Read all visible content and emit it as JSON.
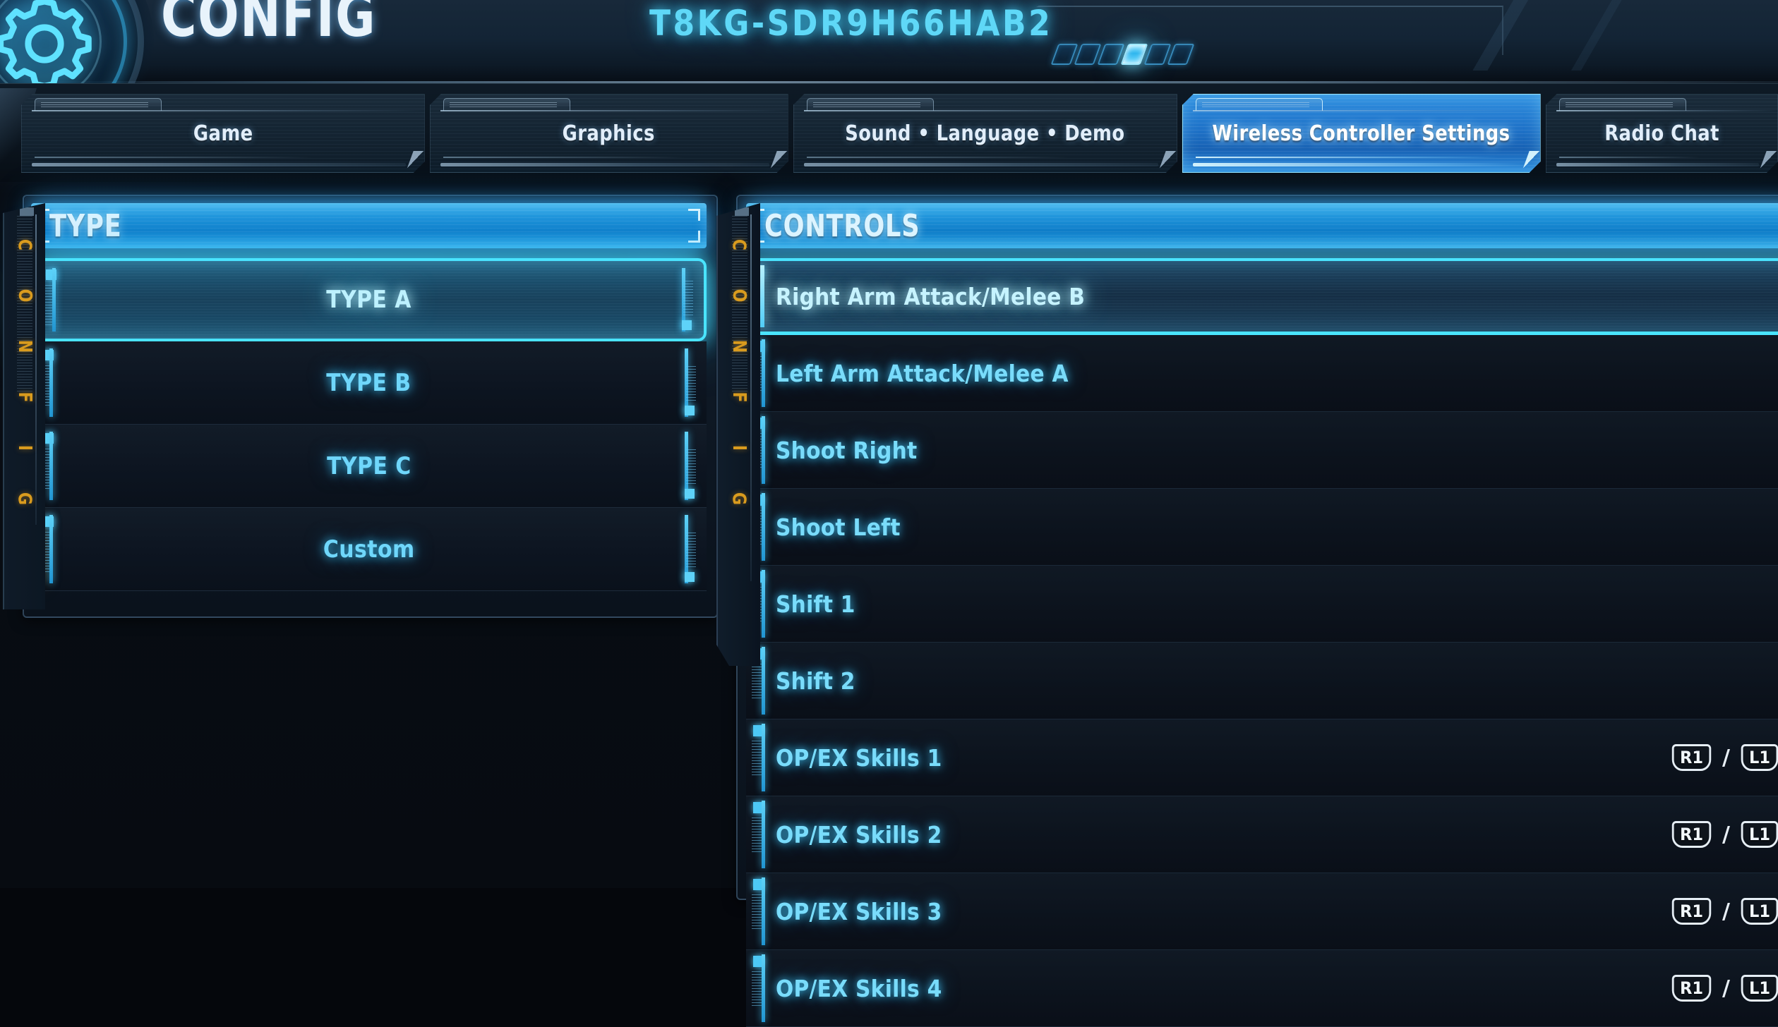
{
  "header": {
    "title": "CONFIG",
    "code": "T8KG-SDR9H66HAB2",
    "gear_icon": "gear-icon",
    "segments": {
      "count": 6,
      "active_index": 3
    },
    "accent_cyan": "#4ae4ff",
    "accent_blue": "#1f93da",
    "accent_amber": "#d99b1e"
  },
  "tabs": [
    {
      "label": "Game",
      "active": false
    },
    {
      "label": "Graphics",
      "active": false
    },
    {
      "label": "Sound  •  Language  •  Demo",
      "active": false
    },
    {
      "label": "Wireless Controller Settings",
      "active": true
    },
    {
      "label": "Radio Chat",
      "active": false
    }
  ],
  "type_panel": {
    "rail_label": "CONFIG",
    "rail_letters": [
      "C",
      "O",
      "N",
      "F",
      "I",
      "G"
    ],
    "heading": "TYPE",
    "items": [
      {
        "label": "TYPE A",
        "selected": true,
        "marker": "none"
      },
      {
        "label": "TYPE B",
        "selected": false,
        "marker": "gray"
      },
      {
        "label": "TYPE C",
        "selected": false,
        "marker": "gray"
      },
      {
        "label": "Custom",
        "selected": false,
        "marker": "amber"
      }
    ]
  },
  "controls_panel": {
    "rail_label": "CONFIG",
    "rail_letters": [
      "C",
      "O",
      "N",
      "F",
      "I",
      "G"
    ],
    "heading": "CONTROLS",
    "bind_separator": "/",
    "rows": [
      {
        "label": "Right Arm Attack/Melee B",
        "selected": true,
        "binds": []
      },
      {
        "label": "Left Arm Attack/Melee A",
        "selected": false,
        "binds": []
      },
      {
        "label": "Shoot Right",
        "selected": false,
        "binds": []
      },
      {
        "label": "Shoot Left",
        "selected": false,
        "binds": []
      },
      {
        "label": "Shift 1",
        "selected": false,
        "binds": []
      },
      {
        "label": "Shift 2",
        "selected": false,
        "binds": []
      },
      {
        "label": "OP/EX Skills 1",
        "selected": false,
        "binds": [
          "R1",
          "L1"
        ]
      },
      {
        "label": "OP/EX Skills 2",
        "selected": false,
        "binds": [
          "R1",
          "L1"
        ]
      },
      {
        "label": "OP/EX Skills 3",
        "selected": false,
        "binds": [
          "R1",
          "L1"
        ]
      },
      {
        "label": "OP/EX Skills 4",
        "selected": false,
        "binds": [
          "R1",
          "L1"
        ]
      }
    ]
  }
}
